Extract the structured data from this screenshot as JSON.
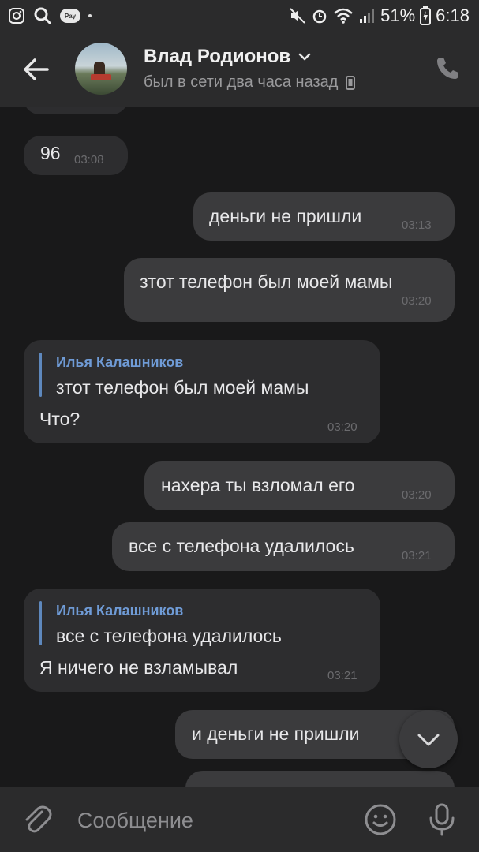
{
  "status_bar": {
    "pay_label": "Pay",
    "battery": "51%",
    "time": "6:18"
  },
  "header": {
    "contact_name": "Влад Родионов",
    "last_seen": "был в сети два часа назад",
    "icons": [
      "back-arrow-icon",
      "chevron-down-icon",
      "mobile-device-icon",
      "phone-icon"
    ]
  },
  "messages": [
    {
      "dir": "in",
      "text": "96",
      "time": "03:08"
    },
    {
      "dir": "out",
      "text": "деньги не пришли",
      "time": "03:13"
    },
    {
      "dir": "out",
      "text": "зтот телефон был моей мамы",
      "time": "03:20"
    },
    {
      "dir": "in",
      "reply_author": "Илья Калашников",
      "reply_text": "зтот телефон был моей мамы",
      "text": "Что?",
      "time": "03:20"
    },
    {
      "dir": "out",
      "text": "нахера ты взломал его",
      "time": "03:20"
    },
    {
      "dir": "out",
      "text": "все с телефона удалилось",
      "time": "03:21"
    },
    {
      "dir": "in",
      "reply_author": "Илья Калашников",
      "reply_text": "все с телефона удалилось",
      "text": "Я ничего не взламывал",
      "time": "03:21"
    },
    {
      "dir": "out",
      "text": "и деньги не пришли",
      "time": ""
    }
  ],
  "composer": {
    "placeholder": "Сообщение"
  },
  "colors": {
    "background": "#19191a",
    "bar": "#2b2b2c",
    "incoming_bubble": "#2d2d2f",
    "outgoing_bubble": "#3b3b3d",
    "reply_accent": "#6f9bd6"
  }
}
